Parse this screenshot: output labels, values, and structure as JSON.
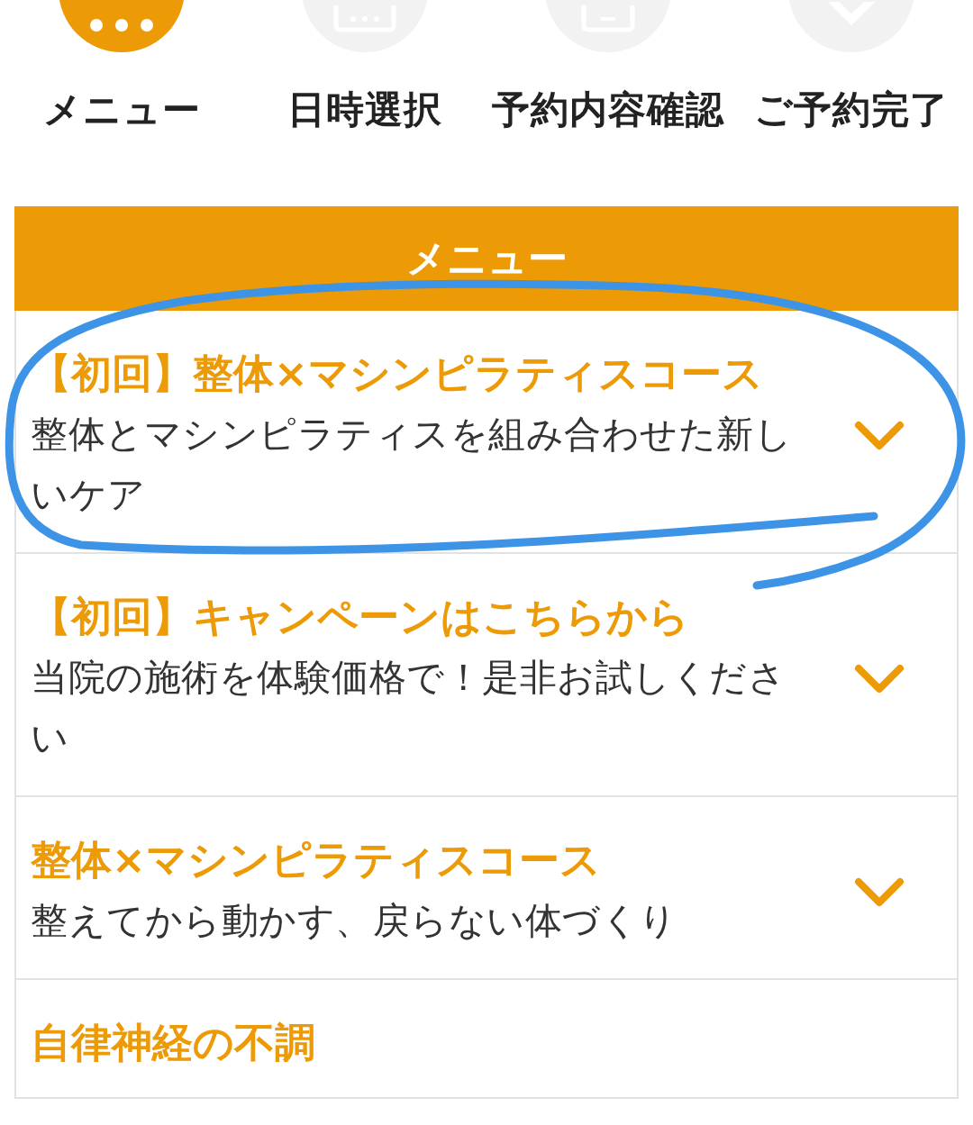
{
  "steps": [
    {
      "label": "メニュー",
      "kind": "menu",
      "selected": true
    },
    {
      "label": "日時選択",
      "kind": "calendar",
      "selected": false
    },
    {
      "label": "予約内容確認",
      "kind": "document",
      "selected": false
    },
    {
      "label": "ご予約完了",
      "kind": "check",
      "selected": false
    }
  ],
  "section_title": "メニュー",
  "menu_items": [
    {
      "title": "【初回】整体×マシンピラティスコース",
      "description": "整体とマシンピラティスを組み合わせた新しいケア",
      "circled": true
    },
    {
      "title": "【初回】キャンペーンはこちらから",
      "description": "当院の施術を体験価格で！是非お試しください",
      "circled": false
    },
    {
      "title": "整体×マシンピラティスコース",
      "description": "整えてから動かす、戻らない体づくり",
      "circled": false
    },
    {
      "title": "自律神経の不調",
      "circled": false
    }
  ]
}
